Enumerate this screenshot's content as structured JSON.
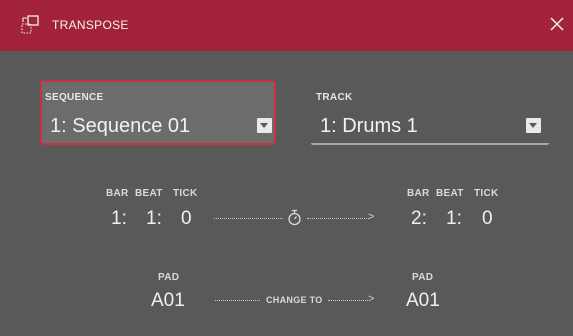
{
  "window": {
    "title": "TRANSPOSE",
    "icons": {
      "title": "transpose-icon",
      "close": "close-icon"
    }
  },
  "sequence": {
    "label": "SEQUENCE",
    "value": "1: Sequence 01"
  },
  "track": {
    "label": "TRACK",
    "value": "1: Drums 1"
  },
  "from": {
    "labels": {
      "bar": "BAR",
      "beat": "BEAT",
      "tick": "TICK"
    },
    "bar": "1:",
    "beat": "1:",
    "tick": "0"
  },
  "to": {
    "labels": {
      "bar": "BAR",
      "beat": "BEAT",
      "tick": "TICK"
    },
    "bar": "2:",
    "beat": "1:",
    "tick": "0"
  },
  "pad_from": {
    "label": "PAD",
    "value": "A01"
  },
  "pad_to": {
    "label": "PAD",
    "value": "A01"
  },
  "change_to_label": "CHANGE TO",
  "colors": {
    "titlebar": "#a2223a",
    "background": "#595959",
    "selected_border": "#c8323f"
  }
}
